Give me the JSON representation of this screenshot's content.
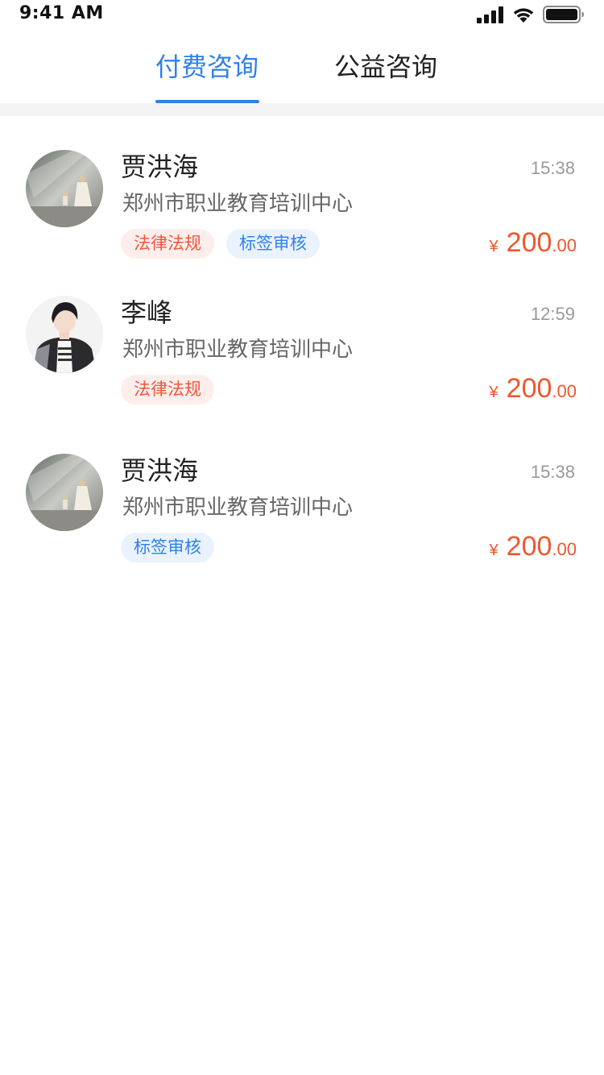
{
  "status_bar": {
    "time": "9:41 AM"
  },
  "tabs": [
    {
      "label": "付费咨询",
      "active": true
    },
    {
      "label": "公益咨询",
      "active": false
    }
  ],
  "colors": {
    "accent": "#2f80ed",
    "price": "#f0562f",
    "tag_red_text": "#f0563c",
    "tag_red_bg": "#fdeeec",
    "tag_blue_text": "#2f80ed",
    "tag_blue_bg": "#eaf2fd"
  },
  "consultations": [
    {
      "name": "贾洪海",
      "organization": "郑州市职业教育培训中心",
      "time": "15:38",
      "tags": [
        "法律法规",
        "标签审核"
      ],
      "price": {
        "currency": "¥",
        "integer": "200",
        "decimal": ".00"
      },
      "avatar": "avatar-woman-child-photo"
    },
    {
      "name": "李峰",
      "organization": "郑州市职业教育培训中心",
      "time": "12:59",
      "tags": [
        "法律法规"
      ],
      "price": {
        "currency": "¥",
        "integer": "200",
        "decimal": ".00"
      },
      "avatar": "avatar-young-man-illustration"
    },
    {
      "name": "贾洪海",
      "organization": "郑州市职业教育培训中心",
      "time": "15:38",
      "tags": [
        "标签审核"
      ],
      "price": {
        "currency": "¥",
        "integer": "200",
        "decimal": ".00"
      },
      "avatar": "avatar-woman-child-photo"
    }
  ]
}
